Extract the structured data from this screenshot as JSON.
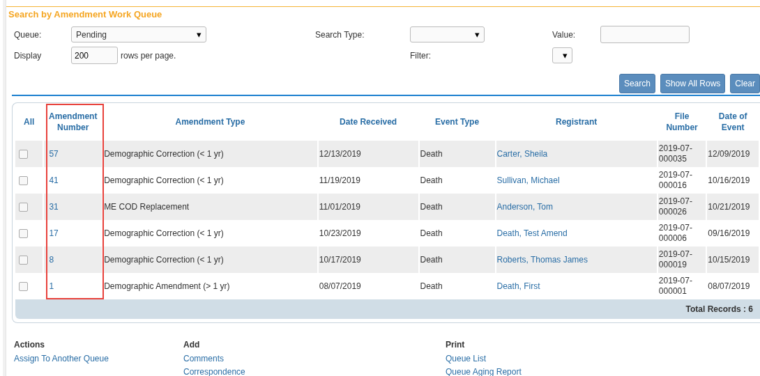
{
  "page_title": "Search by Amendment Work Queue",
  "form": {
    "queue": {
      "label": "Queue:",
      "value": "Pending"
    },
    "display": {
      "label": "Display",
      "value": "200",
      "suffix": "rows per page."
    },
    "search_type": {
      "label": "Search Type:"
    },
    "filter": {
      "label": "Filter:"
    },
    "value_field": {
      "label": "Value:"
    }
  },
  "dropdown_caret": "▾",
  "buttons": [
    "Search",
    "Show All Rows",
    "Clear"
  ],
  "table": {
    "columns": [
      {
        "label": "All",
        "highlighted": false
      },
      {
        "label": "Amendment Number",
        "highlighted": true
      },
      {
        "label": "Amendment Type",
        "highlighted": false
      },
      {
        "label": "Date Received",
        "highlighted": false
      },
      {
        "label": "Event Type",
        "highlighted": false
      },
      {
        "label": "Registrant",
        "highlighted": false
      },
      {
        "label": "File Number",
        "highlighted": false
      },
      {
        "label": "Date of Event",
        "highlighted": false
      }
    ],
    "rows": [
      {
        "checked": false,
        "amendment_number": "57",
        "amendment_type": "Demographic Correction (< 1 yr)",
        "date_received": "12/13/2019",
        "event_type": "Death",
        "registrant": "Carter, Sheila",
        "file_number": "2019-07-000035",
        "date_of_event": "12/09/2019"
      },
      {
        "checked": false,
        "amendment_number": "41",
        "amendment_type": "Demographic Correction (< 1 yr)",
        "date_received": "11/19/2019",
        "event_type": "Death",
        "registrant": "Sullivan, Michael",
        "file_number": "2019-07-000016",
        "date_of_event": "10/16/2019"
      },
      {
        "checked": false,
        "amendment_number": "31",
        "amendment_type": "ME COD Replacement",
        "date_received": "11/01/2019",
        "event_type": "Death",
        "registrant": "Anderson, Tom",
        "file_number": "2019-07-000026",
        "date_of_event": "10/21/2019"
      },
      {
        "checked": false,
        "amendment_number": "17",
        "amendment_type": "Demographic Correction (< 1 yr)",
        "date_received": "10/23/2019",
        "event_type": "Death",
        "registrant": "Death, Test Amend",
        "file_number": "2019-07-000006",
        "date_of_event": "09/16/2019"
      },
      {
        "checked": false,
        "amendment_number": "8",
        "amendment_type": "Demographic Correction (< 1 yr)",
        "date_received": "10/17/2019",
        "event_type": "Death",
        "registrant": "Roberts, Thomas James",
        "file_number": "2019-07-000019",
        "date_of_event": "10/15/2019"
      },
      {
        "checked": false,
        "amendment_number": "1",
        "amendment_type": "Demographic Amendment (> 1 yr)",
        "date_received": "08/07/2019",
        "event_type": "Death",
        "registrant": "Death, First",
        "file_number": "2019-07-000001",
        "date_of_event": "08/07/2019"
      }
    ],
    "footer": "Total Records : 6"
  },
  "link_groups": [
    {
      "heading": "Actions",
      "items": [
        "Assign To Another Queue"
      ]
    },
    {
      "heading": "Add",
      "items": [
        "Comments",
        "Correspondence"
      ]
    },
    {
      "heading": "Print",
      "items": [
        "Queue List",
        "Queue Aging Report"
      ]
    }
  ]
}
